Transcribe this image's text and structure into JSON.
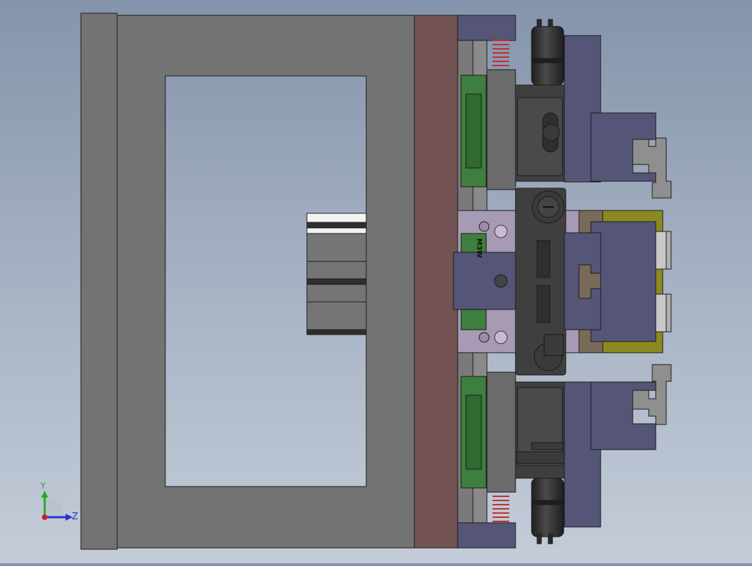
{
  "viewport": {
    "background_top": "#8494ab",
    "background_bottom": "#c4ccd8"
  },
  "triad": {
    "y_label": "Y",
    "z_label": "Z",
    "y_color": "#22aa22",
    "z_color": "#2233cc",
    "origin_color": "#cc2222"
  },
  "part_label": {
    "text": "M3W"
  },
  "colors": {
    "frame": "#737373",
    "plate": "#735353",
    "slide": "#555577",
    "block": "#3f3f3f",
    "guide": "#3e7e3e",
    "bracket": "#8f8f8f",
    "insert": "#8a8a20",
    "spring": "#c03030"
  }
}
